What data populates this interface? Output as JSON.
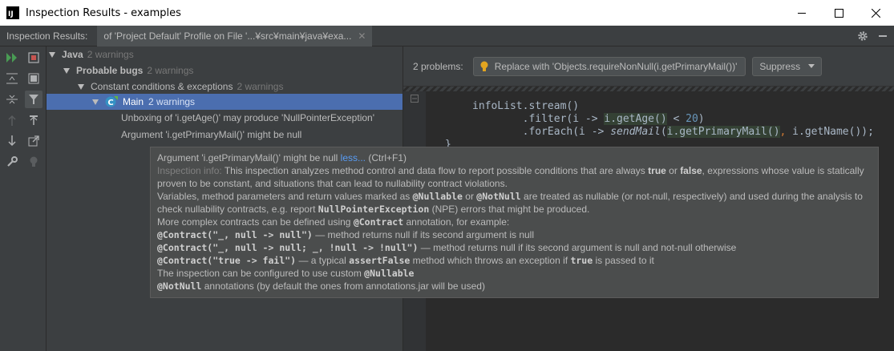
{
  "window": {
    "title": "Inspection Results - examples"
  },
  "tabbar": {
    "label": "Inspection Results:",
    "tab_title": "of 'Project Default' Profile on File '...¥src¥main¥java¥exa...",
    "tab_close": "✕"
  },
  "tree": {
    "nodes": [
      {
        "label": "Java",
        "count": "2 warnings"
      },
      {
        "label": "Probable bugs",
        "count": "2 warnings"
      },
      {
        "label": "Constant conditions & exceptions",
        "count": "2 warnings"
      },
      {
        "label": "Main",
        "count": "2 warnings"
      },
      {
        "label": "Unboxing of 'i.getAge()' may produce 'NullPointerException'"
      },
      {
        "label": "Argument 'i.getPrimaryMail()' might be null"
      }
    ]
  },
  "problems": {
    "count_label": "2 problems:",
    "fix_label": "Replace with 'Objects.requireNonNull(i.getPrimaryMail())'",
    "suppress_label": "Suppress"
  },
  "editor": {
    "line1": "infoList.stream()",
    "line2_pre": "        .filter(i -> ",
    "line2_hl": "i.getAge()",
    "line2_op": " < ",
    "line2_num": "20",
    "line2_post": ")",
    "line3_pre": "        .forEach(i -> ",
    "line3_method": "sendMail",
    "line3_open": "(",
    "line3_hl": "i.getPrimaryMail()",
    "line3_comma": ",",
    "line3_post": " i.getName());",
    "line4": "}"
  },
  "popup": {
    "head": "Argument 'i.getPrimaryMail()' might be null",
    "head_link": "less...",
    "head_shortcut": "(Ctrl+F1)",
    "info_label": "Inspection info:",
    "l1_a": "This inspection analyzes method control and data flow to report possible conditions that are always",
    "l1_true": "true",
    "l1_or": "or",
    "l1_false": "false",
    "l1_b": ", expressions whose value is statically",
    "l2": "proven to be constant, and situations that can lead to nullability contract violations.",
    "l3_a": "Variables, method parameters and return values marked as",
    "l3_nullable": "@Nullable",
    "l3_or": "or",
    "l3_notnull": "@NotNull",
    "l3_b": "are treated as nullable (or not-null, respectively) and used during the analysis to",
    "l4_a": "check nullability contracts, e.g. report",
    "l4_npe": "NullPointerException",
    "l4_b": "(NPE) errors that might be produced.",
    "l5_a": "More complex contracts can be defined using",
    "l5_contract": "@Contract",
    "l5_b": "annotation, for example:",
    "l6_code": "@Contract(\"_, null -> null\")",
    "l6_text": "— method returns null if its second argument is null",
    "l7_code": "@Contract(\"_, null -> null; _, !null -> !null\")",
    "l7_text": "— method returns null if its second argument is null and not-null otherwise",
    "l8_code": "@Contract(\"true -> fail\")",
    "l8_a": "— a typical",
    "l8_assert": "assertFalse",
    "l8_b": "method which throws an exception if",
    "l8_true": "true",
    "l8_c": "is passed to it",
    "l9_a": "The inspection can be configured to use custom",
    "l9_nullable": "@Nullable",
    "l10_notnull": "@NotNull",
    "l10_b": "annotations (by default the ones from annotations.jar will be used)"
  }
}
